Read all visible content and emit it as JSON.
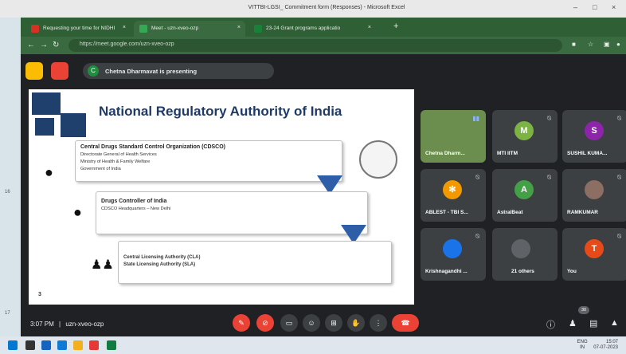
{
  "excel": {
    "title": "VITTBI-LGSI_ Commitment form (Responses) - Microsoft Excel",
    "row_numbers": [
      "16",
      "17"
    ],
    "controls": [
      "–",
      "□",
      "×"
    ]
  },
  "browser": {
    "tabs": [
      {
        "label": "Requesting your time for NIDHI",
        "favicon_color": "#d93025"
      },
      {
        "label": "Meet - uzn-xveo-ozp",
        "favicon_color": "#34a853",
        "active": true
      },
      {
        "label": "23-24 Grant programs applicatio",
        "favicon_color": "#188038"
      }
    ],
    "new_tab": "+",
    "url": "https://meet.google.com/uzn-xveo-ozp"
  },
  "meet": {
    "presenting_text": "Chetna Dharmavat is presenting",
    "presenter_initial": "C",
    "slide": {
      "title": "National Regulatory Authority of India",
      "slide_number": "3",
      "boxes": [
        {
          "heading": "Central Drugs Standard Control Organization (CDSCO)",
          "lines": [
            "Directorate General of Health Services",
            "Ministry of Health & Family Welfare",
            "Government of India"
          ]
        },
        {
          "heading": "Drugs Controller of India",
          "lines": [
            "CDSCO Headquarters – New Delhi"
          ]
        },
        {
          "heading": "",
          "lines": [
            "Central Licensing Authority (CLA)",
            "State Licensing Authority (SLA)"
          ]
        }
      ]
    },
    "participants": [
      {
        "name": "Chetna Dharm...",
        "initial": "",
        "color": "#6b8e4e",
        "video": true
      },
      {
        "name": "MTI IITM",
        "initial": "M",
        "color": "#7cb342"
      },
      {
        "name": "SUSHIL KUMA...",
        "initial": "S",
        "color": "#8e24aa"
      },
      {
        "name": "ABLEST - TBI S...",
        "initial": "",
        "color": "#f29900"
      },
      {
        "name": "AstralBeat",
        "initial": "A",
        "color": "#43a047"
      },
      {
        "name": "RAMKUMAR",
        "initial": "",
        "color": "#8d6e63"
      },
      {
        "name": "Krishnagandhi ...",
        "initial": "",
        "color": "#1a73e8"
      },
      {
        "name": "21 others",
        "initial": "",
        "color": "#5f6368"
      },
      {
        "name": "You",
        "initial": "T",
        "color": "#e64a19"
      }
    ],
    "time": "3:07 PM",
    "separator": "|",
    "meeting_code": "uzn-xveo-ozp",
    "participant_count": "30"
  },
  "taskbar": {
    "lang": "ENG",
    "lang_sub": "IN",
    "clock_time": "15:07",
    "clock_date": "07-07-2023"
  }
}
